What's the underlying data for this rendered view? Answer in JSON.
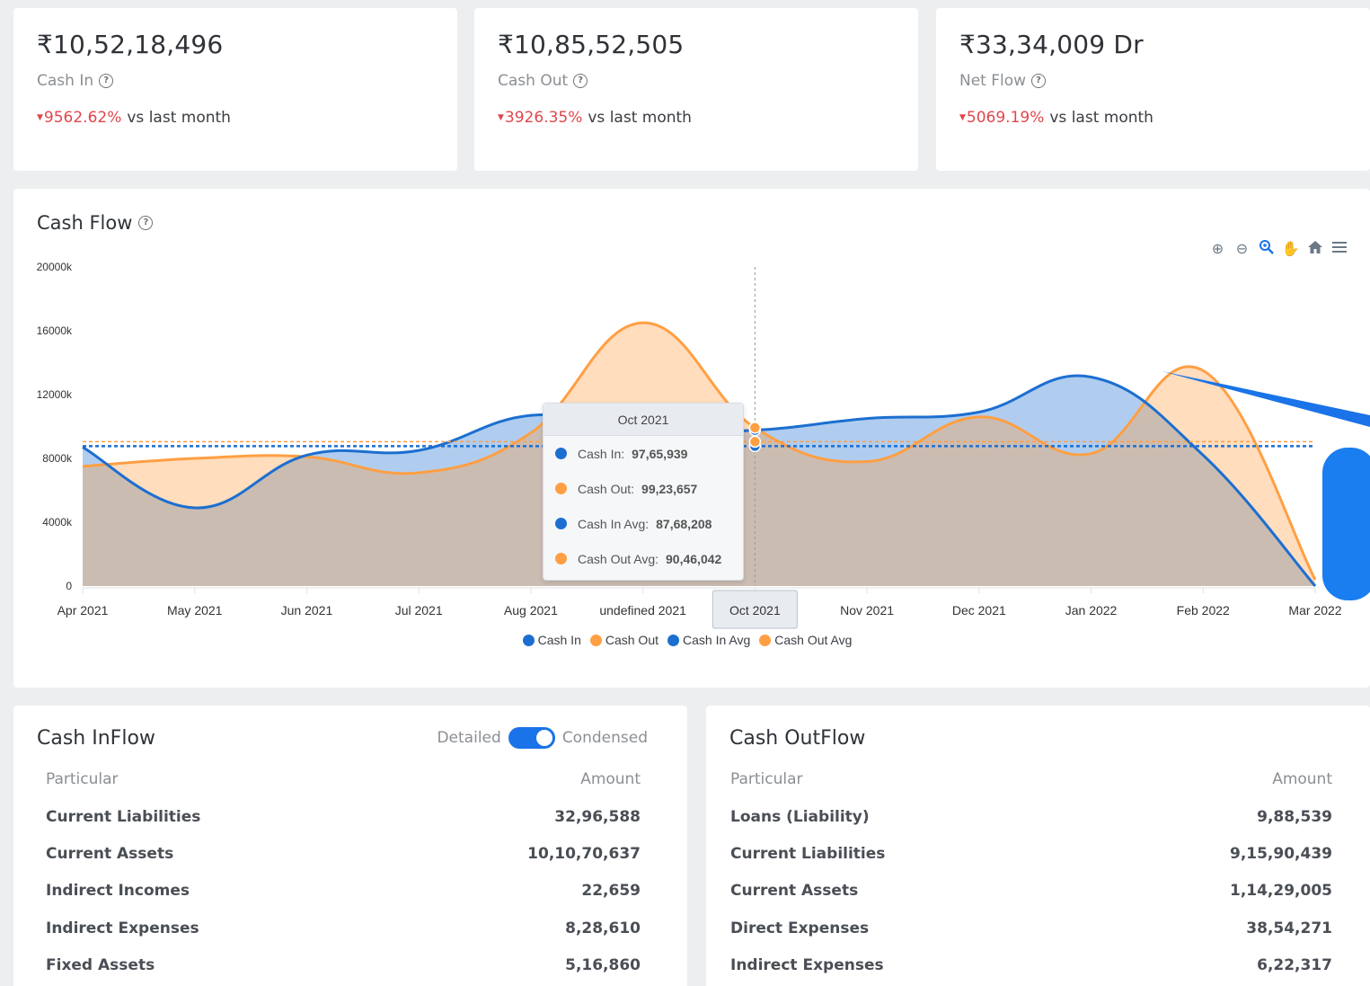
{
  "kpis": [
    {
      "amount": "₹10,52,18,496",
      "label": "Cash In",
      "change": "9562.62%",
      "suffix": "vs last month"
    },
    {
      "amount": "₹10,85,52,505",
      "label": "Cash Out",
      "change": "3926.35%",
      "suffix": "vs last month"
    },
    {
      "amount": "₹33,34,009 Dr",
      "label": "Net Flow",
      "change": "5069.19%",
      "suffix": "vs last month"
    }
  ],
  "cashflow": {
    "title": "Cash Flow",
    "toolbar_icons": [
      "zoom-in-icon",
      "zoom-out-icon",
      "selection-zoom-icon",
      "pan-hand-icon",
      "home-reset-icon",
      "menu-icon"
    ]
  },
  "chart_data": {
    "type": "area",
    "categories": [
      "Apr 2021",
      "May 2021",
      "Jun 2021",
      "Jul 2021",
      "Aug 2021",
      "undefined 2021",
      "Oct 2021",
      "Nov 2021",
      "Dec 2021",
      "Jan 2022",
      "Feb 2022",
      "Mar 2022"
    ],
    "yticks": [
      "20000k",
      "16000k",
      "12000k",
      "8000k",
      "4000k",
      "0"
    ],
    "ylim": [
      0,
      20000000
    ],
    "series": [
      {
        "name": "Cash In",
        "color": "#1c6fd0",
        "values": [
          8700000,
          4900000,
          8200000,
          8500000,
          10700000,
          9800000,
          9765939,
          10500000,
          10900000,
          13100000,
          8200000,
          0
        ]
      },
      {
        "name": "Cash Out",
        "color": "#ff9f43",
        "values": [
          7500000,
          8000000,
          8100000,
          7100000,
          9600000,
          16500000,
          9923657,
          7800000,
          10600000,
          8300000,
          13500000,
          400000
        ]
      },
      {
        "name": "Cash In Avg",
        "color": "#1c6fd0",
        "values": [
          8768208,
          8768208,
          8768208,
          8768208,
          8768208,
          8768208,
          8768208,
          8768208,
          8768208,
          8768208,
          8768208,
          8768208
        ]
      },
      {
        "name": "Cash Out Avg",
        "color": "#ff9f43",
        "values": [
          9046042,
          9046042,
          9046042,
          9046042,
          9046042,
          9046042,
          9046042,
          9046042,
          9046042,
          9046042,
          9046042,
          9046042
        ]
      }
    ],
    "legend": "bottom-center",
    "tooltip": {
      "title": "Oct 2021",
      "rows": [
        {
          "label": "Cash In:",
          "value": "97,65,939",
          "color": "#1c6fd0"
        },
        {
          "label": "Cash Out:",
          "value": "99,23,657",
          "color": "#ff9f43"
        },
        {
          "label": "Cash In Avg:",
          "value": "87,68,208",
          "color": "#1c6fd0"
        },
        {
          "label": "Cash Out Avg:",
          "value": "90,46,042",
          "color": "#ff9f43"
        }
      ]
    },
    "highlighted_category": "Oct 2021"
  },
  "inflow": {
    "title": "Cash InFlow",
    "toggle_left": "Detailed",
    "toggle_right": "Condensed",
    "col_particular": "Particular",
    "col_amount": "Amount",
    "rows": [
      {
        "particular": "Current Liabilities",
        "amount": "32,96,588"
      },
      {
        "particular": "Current Assets",
        "amount": "10,10,70,637"
      },
      {
        "particular": "Indirect Incomes",
        "amount": "22,659"
      },
      {
        "particular": "Indirect Expenses",
        "amount": "8,28,610"
      },
      {
        "particular": "Fixed Assets",
        "amount": "5,16,860"
      }
    ]
  },
  "outflow": {
    "title": "Cash OutFlow",
    "col_particular": "Particular",
    "col_amount": "Amount",
    "rows": [
      {
        "particular": "Loans (Liability)",
        "amount": "9,88,539"
      },
      {
        "particular": "Current Liabilities",
        "amount": "9,15,90,439"
      },
      {
        "particular": "Current Assets",
        "amount": "1,14,29,005"
      },
      {
        "particular": "Direct Expenses",
        "amount": "38,54,271"
      },
      {
        "particular": "Indirect Expenses",
        "amount": "6,22,317"
      }
    ]
  }
}
